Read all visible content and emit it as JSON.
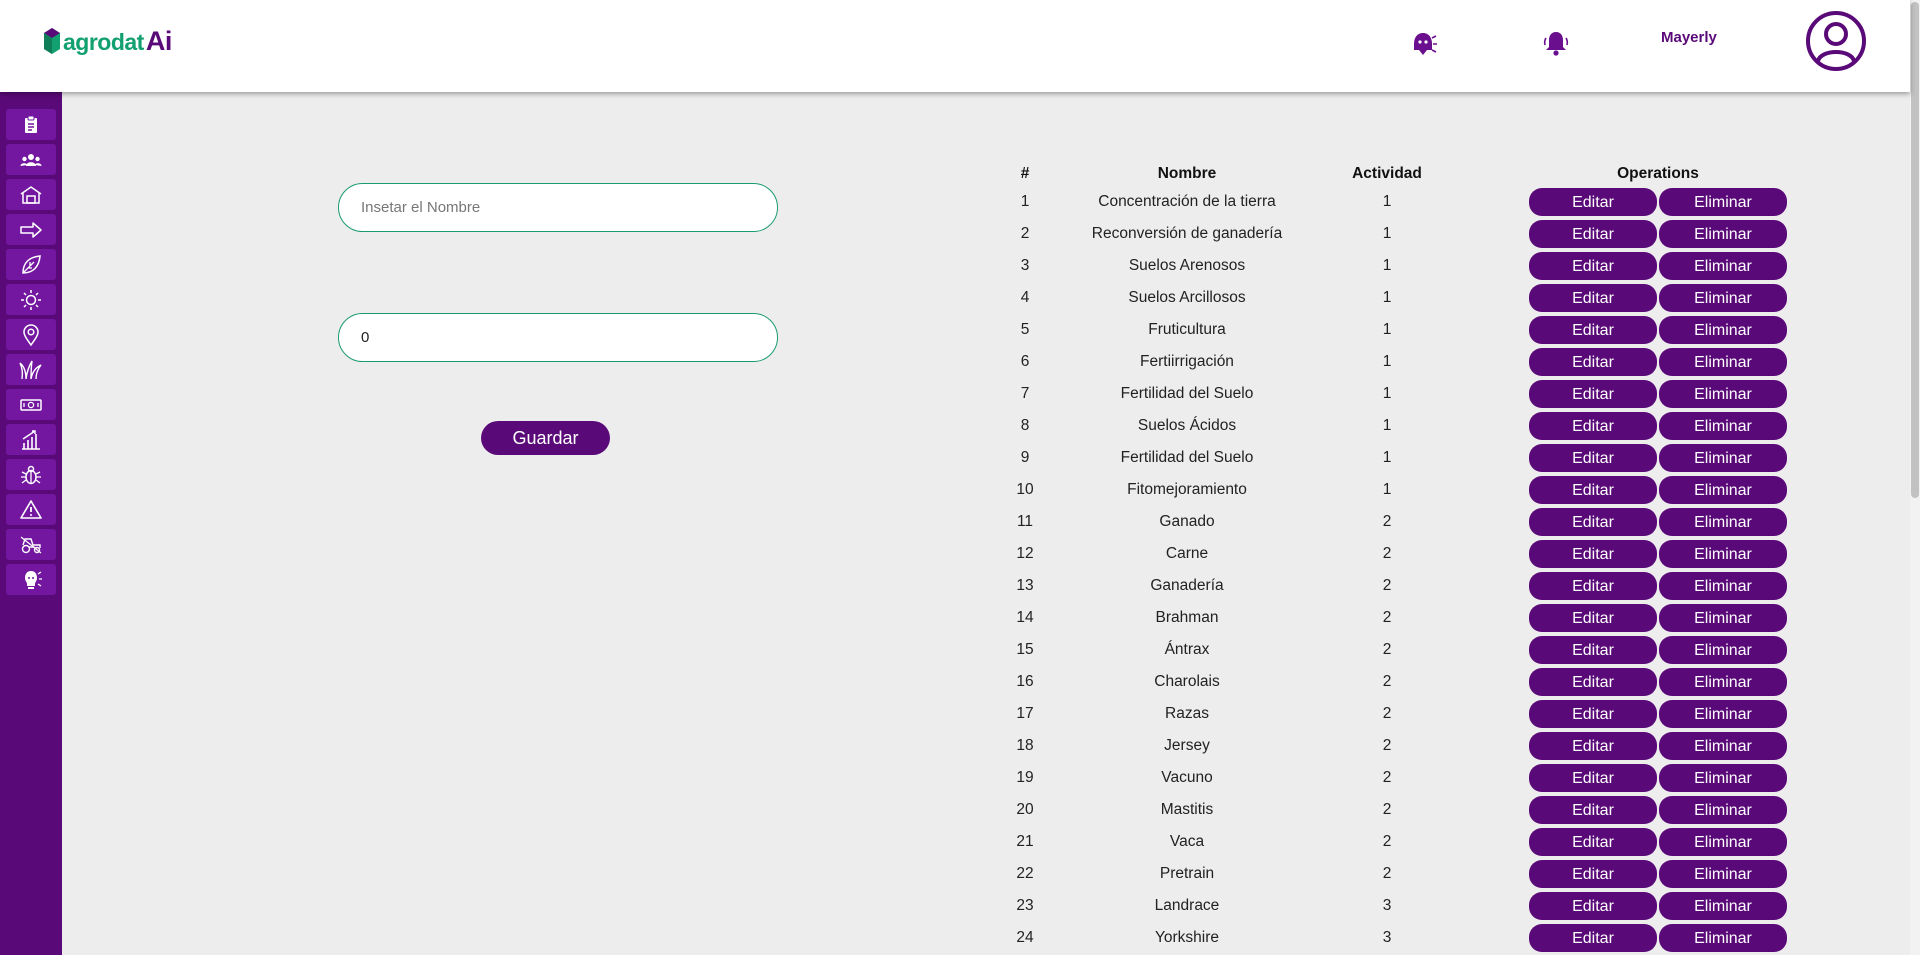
{
  "brand": {
    "name_prefix": "agrodat",
    "name_suffix": "Ai"
  },
  "header": {
    "user_name": "Mayerly"
  },
  "sidebar": {
    "items": [
      {
        "icon": "clipboard-icon"
      },
      {
        "icon": "users-icon"
      },
      {
        "icon": "barn-icon"
      },
      {
        "icon": "arrow-right-icon"
      },
      {
        "icon": "leaf-icon"
      },
      {
        "icon": "sun-icon"
      },
      {
        "icon": "map-pin-icon"
      },
      {
        "icon": "grass-icon"
      },
      {
        "icon": "money-icon"
      },
      {
        "icon": "growth-chart-icon"
      },
      {
        "icon": "bug-icon"
      },
      {
        "icon": "warning-icon"
      },
      {
        "icon": "tractor-icon"
      },
      {
        "icon": "ai-bulb-icon"
      }
    ]
  },
  "form": {
    "name_placeholder": "Insetar el Nombre",
    "name_value": "",
    "activity_value": "0",
    "save_label": "Guardar"
  },
  "table": {
    "headers": {
      "num": "#",
      "name": "Nombre",
      "activity": "Actividad",
      "operations": "Operations"
    },
    "edit_label": "Editar",
    "delete_label": "Eliminar",
    "rows": [
      {
        "num": "1",
        "name": "Concentración de la tierra",
        "activity": "1"
      },
      {
        "num": "2",
        "name": "Reconversión de ganadería",
        "activity": "1"
      },
      {
        "num": "3",
        "name": "Suelos Arenosos",
        "activity": "1"
      },
      {
        "num": "4",
        "name": "Suelos Arcillosos",
        "activity": "1"
      },
      {
        "num": "5",
        "name": "Fruticultura",
        "activity": "1"
      },
      {
        "num": "6",
        "name": "Fertiirrigación",
        "activity": "1"
      },
      {
        "num": "7",
        "name": "Fertilidad del Suelo",
        "activity": "1"
      },
      {
        "num": "8",
        "name": "Suelos Ácidos",
        "activity": "1"
      },
      {
        "num": "9",
        "name": "Fertilidad del Suelo",
        "activity": "1"
      },
      {
        "num": "10",
        "name": "Fitomejoramiento",
        "activity": "1"
      },
      {
        "num": "11",
        "name": "Ganado",
        "activity": "2"
      },
      {
        "num": "12",
        "name": "Carne",
        "activity": "2"
      },
      {
        "num": "13",
        "name": "Ganadería",
        "activity": "2"
      },
      {
        "num": "14",
        "name": "Brahman",
        "activity": "2"
      },
      {
        "num": "15",
        "name": "Ántrax",
        "activity": "2"
      },
      {
        "num": "16",
        "name": "Charolais",
        "activity": "2"
      },
      {
        "num": "17",
        "name": "Razas",
        "activity": "2"
      },
      {
        "num": "18",
        "name": "Jersey",
        "activity": "2"
      },
      {
        "num": "19",
        "name": "Vacuno",
        "activity": "2"
      },
      {
        "num": "20",
        "name": "Mastitis",
        "activity": "2"
      },
      {
        "num": "21",
        "name": "Vaca",
        "activity": "2"
      },
      {
        "num": "22",
        "name": "Pretrain",
        "activity": "2"
      },
      {
        "num": "23",
        "name": "Landrace",
        "activity": "3"
      },
      {
        "num": "24",
        "name": "Yorkshire",
        "activity": "3"
      }
    ]
  },
  "colors": {
    "primary": "#5a0a78",
    "sidebar_item": "#7317a0",
    "brand_green": "#13a070",
    "input_border": "#1a9a73",
    "background": "#ededed"
  }
}
